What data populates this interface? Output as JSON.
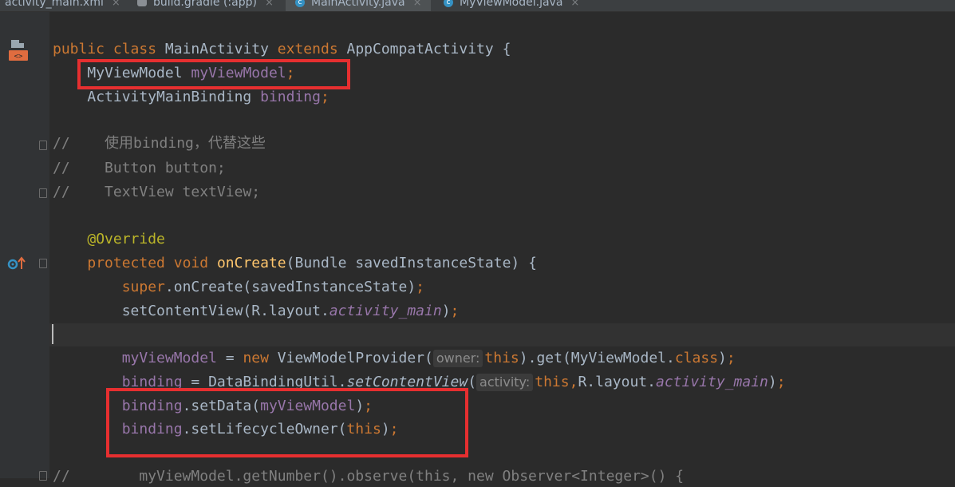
{
  "tabs": [
    {
      "label": "activity_main.xml",
      "icon": "xml-icon"
    },
    {
      "label": "build.gradle (:app)",
      "icon": "gradle-icon"
    },
    {
      "label": "MainActivity.java",
      "icon": "class-icon",
      "active": true
    },
    {
      "label": "MyViewModel.java",
      "icon": "class-icon"
    }
  ],
  "close_glyph": "×",
  "gutter_icons": [
    "layout-file-icon",
    "override-method-icon"
  ],
  "code": {
    "l1": {
      "kw1": "public",
      "kw2": "class",
      "cls": "MainActivity",
      "kw3": "extends",
      "sup": "AppCompatActivity",
      "brace": "{"
    },
    "l2": {
      "type": "MyViewModel",
      "name": "myViewModel",
      "semi": ";"
    },
    "l3": {
      "type": "ActivityMainBinding",
      "name": "binding",
      "semi": ";"
    },
    "l4": "//    使用binding，代替这些",
    "l5": "//    Button button;",
    "l6": "//    TextView textView;",
    "l7": "@Override",
    "l8": {
      "kw1": "protected",
      "kw2": "void",
      "fn": "onCreate",
      "args": "(Bundle savedInstanceState) {"
    },
    "l9": {
      "kw": "super",
      "rest": ".onCreate(savedInstanceState)",
      "semi": ";"
    },
    "l10": {
      "pre": "setContentView(R.layout.",
      "it": "activity_main",
      "post": ")",
      "semi": ";"
    },
    "l12": {
      "fld": "myViewModel",
      "eq": " = ",
      "kw": "new",
      "call": " ViewModelProvider(",
      "hint": "owner:",
      "this": "this",
      "rest": ").get(MyViewModel.",
      "cls": "class",
      "close": ")",
      "semi": ";"
    },
    "l13": {
      "fld": "binding",
      "eq": " = DataBindingUtil.",
      "it": "setContentView",
      "paren": "(",
      "hint": "activity:",
      "this": "this",
      "comma": ",",
      "mid": "R.layout.",
      "it2": "activity_main",
      "close": ")",
      "semi": ";"
    },
    "l14": {
      "fld": "binding",
      "call": ".setData(",
      "arg": "myViewModel",
      "close": ")",
      "semi": ";"
    },
    "l15": {
      "fld": "binding",
      "call": ".setLifecycleOwner(",
      "arg": "this",
      "close": ")",
      "semi": ";"
    },
    "l16": "//        myViewModel.getNumber().observe(this, new Observer<Integer>() {"
  },
  "highlight_color": "#e62f30"
}
